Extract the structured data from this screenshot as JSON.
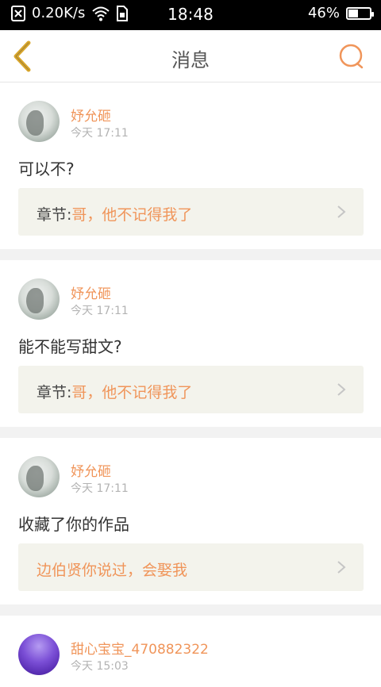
{
  "status_bar": {
    "net_speed": "0.20K/s",
    "time": "18:48",
    "battery": "46%",
    "battery_level": 0.46
  },
  "header": {
    "title": "消息"
  },
  "messages": [
    {
      "user": "妤允砸",
      "time": "今天 17:11",
      "text": "可以不?",
      "chapter_label": "章节:",
      "chapter_title": "哥，他不记得我了"
    },
    {
      "user": "妤允砸",
      "time": "今天 17:11",
      "text": "能不能写甜文?",
      "chapter_label": "章节:",
      "chapter_title": "哥，他不记得我了"
    },
    {
      "user": "妤允砸",
      "time": "今天 17:11",
      "text": "收藏了你的作品",
      "work_title": "边伯贤你说过，会娶我"
    },
    {
      "user": "甜心宝宝_470882322",
      "time": "今天 15:03"
    }
  ],
  "colors": {
    "accent": "#f0955a",
    "back_arrow": "#d9a62b"
  }
}
